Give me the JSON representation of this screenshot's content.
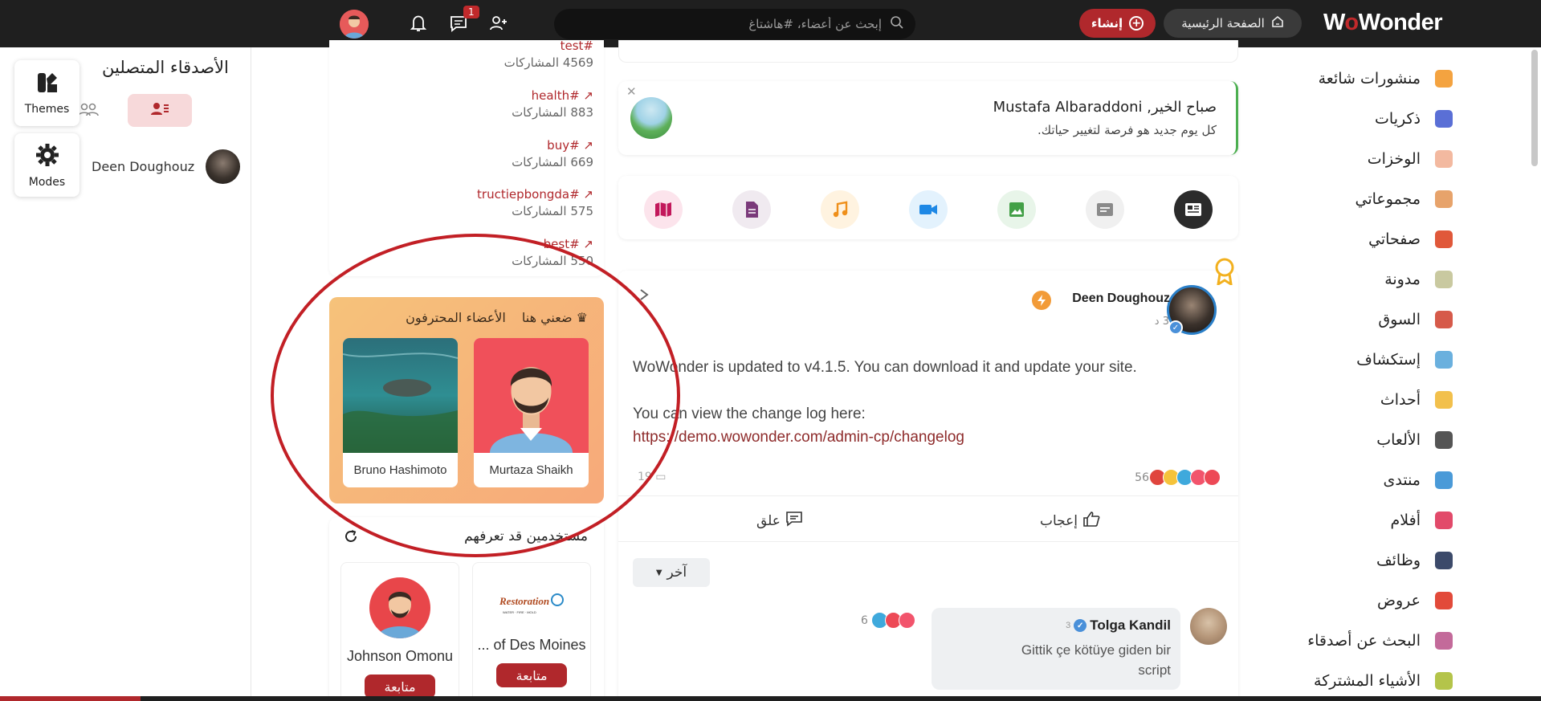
{
  "topbar": {
    "logo": {
      "pre": "W",
      "dot": "o",
      "post": "Wonder"
    },
    "home_label": "الصفحة الرئيسية",
    "create_label": "إنشاء",
    "search_placeholder": "إبحث عن أعضاء، #هاشتاغ",
    "messages_badge": "1",
    "icons": [
      "search-icon",
      "messages-icon",
      "bell-icon",
      "add-friend-icon",
      "home-icon",
      "plus-icon"
    ]
  },
  "friends": {
    "title": "الأصدقاء المتصلين",
    "items": [
      {
        "name": "Deen Doughouz"
      }
    ]
  },
  "floating": {
    "themes_label": "Themes",
    "modes_label": "Modes"
  },
  "trending": [
    {
      "tag": "#test",
      "count": "4569 المشاركات"
    },
    {
      "tag": "#health",
      "count": "883 المشاركات"
    },
    {
      "tag": "#buy",
      "count": "669 المشاركات"
    },
    {
      "tag": "#tructiepbongda",
      "count": "575 المشاركات"
    },
    {
      "tag": "#best",
      "count": "550 المشاركات"
    }
  ],
  "pro": {
    "title": "الأعضاء المحترفون",
    "link": "ضعني هنا",
    "users": [
      {
        "name": "Murtaza Shaikh"
      },
      {
        "name": "Bruno Hashimoto"
      }
    ]
  },
  "suggest": {
    "title": "مستخدمين قد تعرفهم",
    "users": [
      {
        "name": "... of Des Moines",
        "follow": "متابعة"
      },
      {
        "name": "Johnson Omonu",
        "follow": "متابعة"
      }
    ]
  },
  "welcome": {
    "title": "صباح الخير, Mustafa Albaraddoni",
    "subtitle": "كل يوم جديد هو فرصة لتغيير حياتك."
  },
  "composer": {
    "buttons": [
      "article-icon",
      "text-post-icon",
      "image-icon",
      "video-icon",
      "music-icon",
      "file-icon",
      "map-icon"
    ],
    "colors": {
      "article": "#2b2b2b",
      "text": "#f0f0f0",
      "image": "#e8f5e9",
      "video": "#e3f2fd",
      "music": "#fff3e0",
      "file": "#f0eaf0",
      "map": "#fce4ec"
    }
  },
  "post": {
    "author": "Deen Doughouz",
    "time": "3 د",
    "line1": "WoWonder is updated to v4.1.5. You can download it and update your site.",
    "line2": "You can view the change log here:",
    "link": "https://demo.wowonder.com/admin-cp/changelog",
    "reactions_count": "56",
    "comments_count": "19",
    "like_label": "إعجاب",
    "comment_label": "علق",
    "other_label": "آخر",
    "comment": {
      "name": "Tolga Kandil",
      "time": "3",
      "text_line1": "Gittik çe kötüye giden bir",
      "text_line2": "script",
      "reactions": "6"
    }
  },
  "nav": [
    {
      "label": "منشورات شائعة",
      "icon": "fire-icon",
      "color": "#f4a340"
    },
    {
      "label": "ذكريات",
      "icon": "memories-icon",
      "color": "#5a6fd6"
    },
    {
      "label": "الوخزات",
      "icon": "poke-icon",
      "color": "#f3b9a0"
    },
    {
      "label": "مجموعاتي",
      "icon": "groups-icon",
      "color": "#e7a36b"
    },
    {
      "label": "صفحاتي",
      "icon": "flag-icon",
      "color": "#e0583a"
    },
    {
      "label": "مدونة",
      "icon": "blog-icon",
      "color": "#c9c9a0"
    },
    {
      "label": "السوق",
      "icon": "market-icon",
      "color": "#d65a4a"
    },
    {
      "label": "إستكشاف",
      "icon": "explore-icon",
      "color": "#6ab0de"
    },
    {
      "label": "أحداث",
      "icon": "calendar-icon",
      "color": "#f2c04c"
    },
    {
      "label": "الألعاب",
      "icon": "gamepad-icon",
      "color": "#555555"
    },
    {
      "label": "منتدى",
      "icon": "forum-icon",
      "color": "#4a9ad8"
    },
    {
      "label": "أفلام",
      "icon": "film-icon",
      "color": "#e24a6a"
    },
    {
      "label": "وظائف",
      "icon": "briefcase-icon",
      "color": "#3c4a6a"
    },
    {
      "label": "عروض",
      "icon": "offer-icon",
      "color": "#e24a3a"
    },
    {
      "label": "البحث عن أصدقاء",
      "icon": "find-friends-icon",
      "color": "#c36a9a"
    },
    {
      "label": "الأشياء المشتركة",
      "icon": "puzzle-icon",
      "color": "#b4c44a"
    }
  ]
}
